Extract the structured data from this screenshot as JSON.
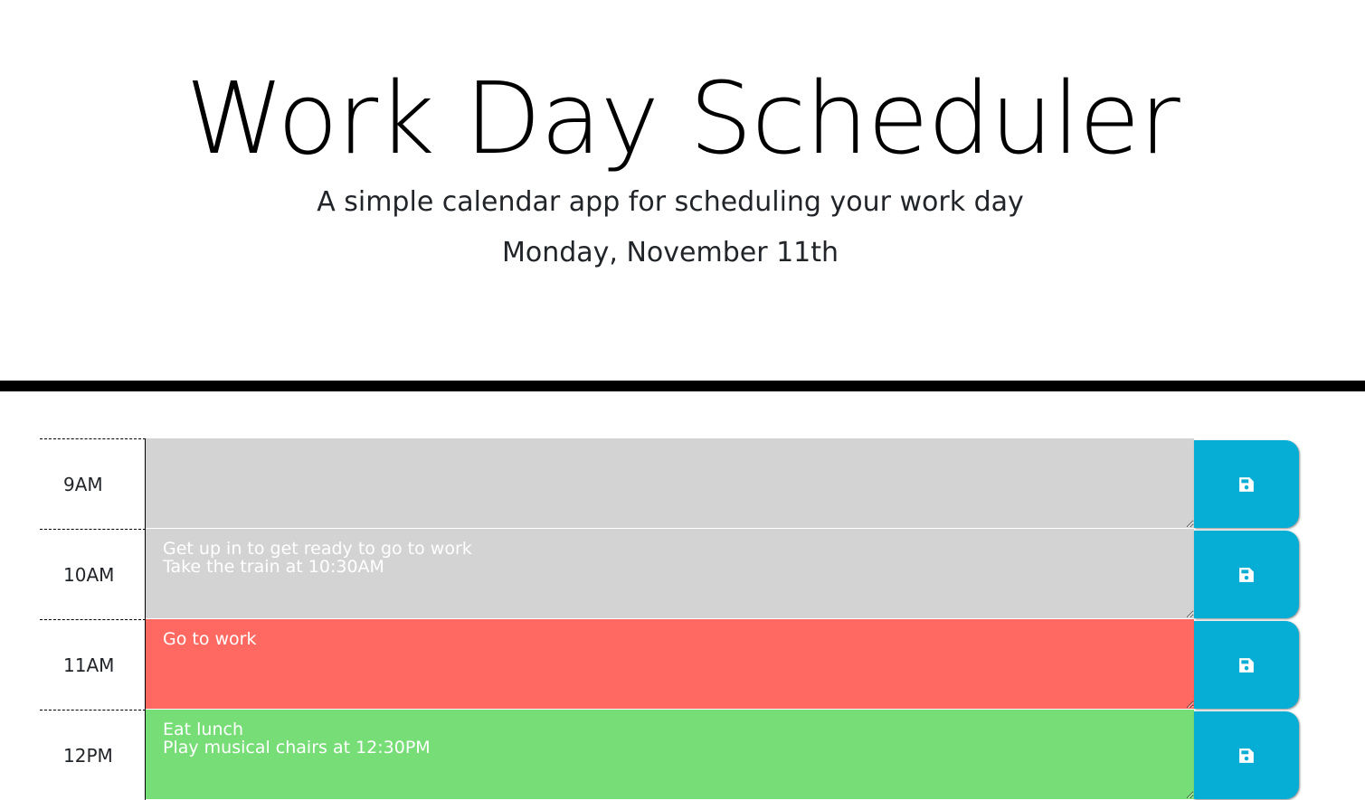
{
  "header": {
    "title": "Work Day Scheduler",
    "subtitle": "A simple calendar app for scheduling your work day",
    "current_day": "Monday, November 11th"
  },
  "colors": {
    "past": "#d3d3d3",
    "present": "#ff6961",
    "future": "#77dd77",
    "save_button": "#06aed5"
  },
  "time_blocks": [
    {
      "hour": "9AM",
      "state": "past",
      "text": ""
    },
    {
      "hour": "10AM",
      "state": "past",
      "text": "Get up in to get ready to go to work\nTake the train at 10:30AM"
    },
    {
      "hour": "11AM",
      "state": "present",
      "text": "Go to work"
    },
    {
      "hour": "12PM",
      "state": "future",
      "text": "Eat lunch\nPlay musical chairs at 12:30PM"
    }
  ],
  "icons": {
    "save": "floppy-disk-icon"
  }
}
